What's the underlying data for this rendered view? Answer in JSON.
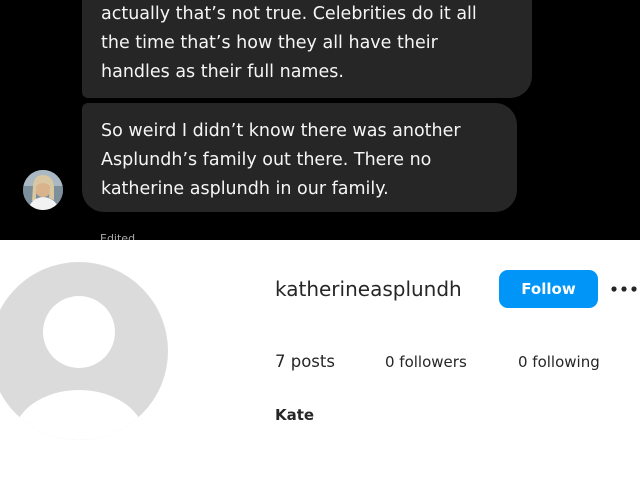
{
  "chat": {
    "message_1_lines": [
      "actually that’s not true. Celebrities do it all",
      "the time that’s how they all have their",
      "handles as their full names."
    ],
    "message_2_lines": [
      "So weird I didn’t know there was another",
      "Asplundh’s family out there. There no",
      "katherine asplundh in our family."
    ],
    "edited_label": "Edited"
  },
  "profile": {
    "username": "katherineasplundh",
    "follow_label": "Follow",
    "more_icon": "more-horizontal-icon",
    "posts": "7 posts",
    "followers": "0 followers",
    "following": "0 following",
    "full_name": "Kate"
  },
  "colors": {
    "chat_background": "#000000",
    "bubble": "#262626",
    "bubble_text": "#f5f5f5",
    "follow_button": "#0095f6",
    "avatar_placeholder": "#dbdbdb"
  }
}
